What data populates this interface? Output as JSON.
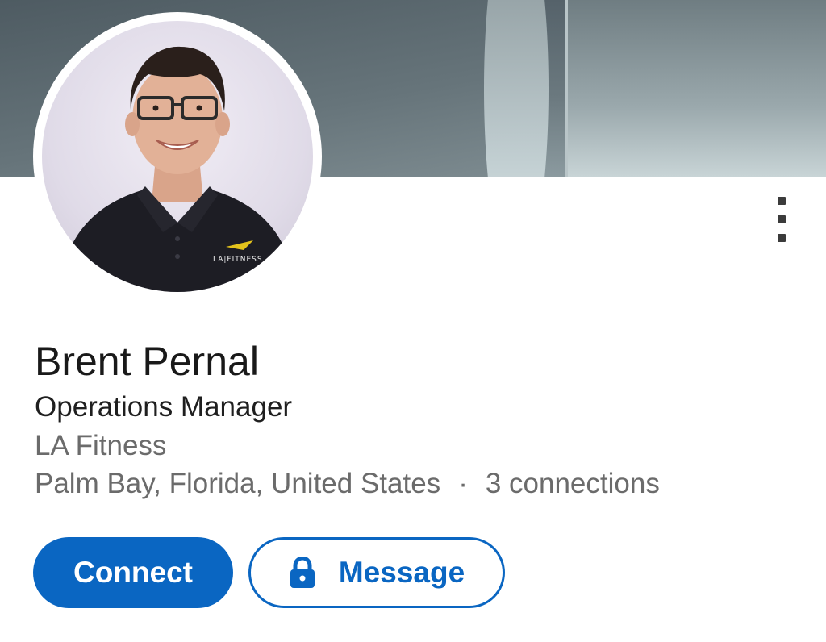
{
  "profile": {
    "name": "Brent Pernal",
    "headline": "Operations Manager",
    "company": "LA Fitness",
    "location": "Palm Bay, Florida, United States",
    "separator": "·",
    "connections": "3 connections",
    "avatar_shirt_logo": "LA|FITNESS."
  },
  "actions": {
    "connect_label": "Connect",
    "message_label": "Message",
    "message_icon": "lock-icon",
    "more_icon": "vertical-ellipsis-icon"
  },
  "colors": {
    "accent": "#0a66c2",
    "name_text": "#191919",
    "secondary_text": "#6b6b6b"
  }
}
